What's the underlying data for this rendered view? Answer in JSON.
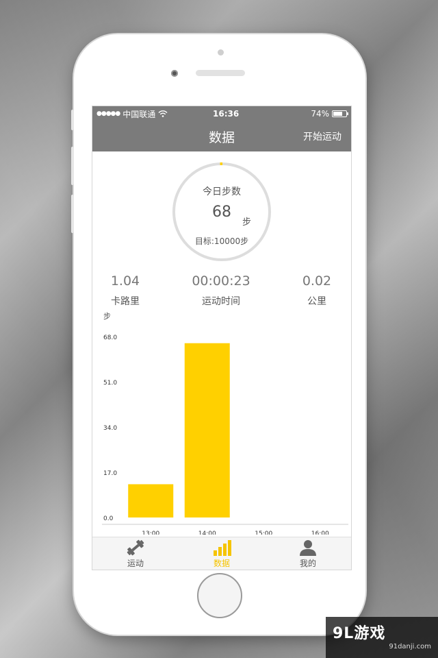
{
  "status_bar": {
    "signal_dots": "●●●●●",
    "carrier": "中国联通",
    "time": "16:36",
    "battery": "74%",
    "battery_level": 0.74
  },
  "nav": {
    "title": "数据",
    "action_label": "开始运动"
  },
  "steps_ring": {
    "label": "今日步数",
    "value": "68",
    "unit": "步",
    "goal": "目标:10000步",
    "progress": 0.0068
  },
  "stats": [
    {
      "value": "1.04",
      "label": "卡路里"
    },
    {
      "value": "00:00:23",
      "label": "运动时间"
    },
    {
      "value": "0.02",
      "label": "公里"
    }
  ],
  "chart_unit": "步",
  "chart_data": {
    "type": "bar",
    "categories": [
      "13:00",
      "14:00",
      "15:00",
      "16:00"
    ],
    "values": [
      12.5,
      65.5,
      0,
      0
    ],
    "yticks": [
      "68.0",
      "51.0",
      "34.0",
      "17.0",
      "0.0"
    ],
    "ylim": [
      0,
      68
    ],
    "title": "",
    "xlabel": "",
    "ylabel": "步",
    "bar_color": "#ffd000",
    "grid": false
  },
  "tabs": [
    {
      "label": "运动",
      "icon": "dumbbell-icon",
      "active": false
    },
    {
      "label": "数据",
      "icon": "bar-chart-icon",
      "active": true
    },
    {
      "label": "我的",
      "icon": "user-icon",
      "active": false
    }
  ],
  "colors": {
    "accent": "#ffd000",
    "header": "#7b7b7b",
    "ring": "#dddddd"
  },
  "watermark": {
    "main": "9L游戏",
    "sub": "91danji.com"
  }
}
